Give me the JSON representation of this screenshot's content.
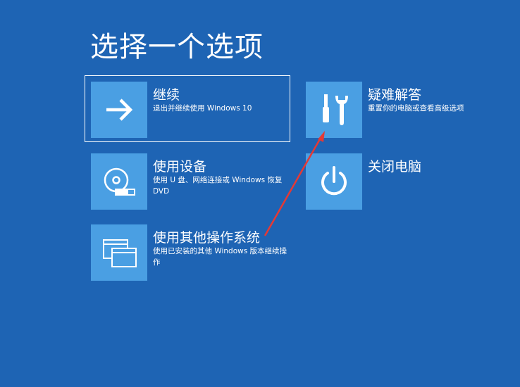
{
  "page": {
    "title": "选择一个选项"
  },
  "options": [
    {
      "label": "继续",
      "description": "退出并继续使用 Windows 10",
      "icon": "arrow-right-icon"
    },
    {
      "label": "使用设备",
      "description": "使用 U 盘、网络连接或 Windows 恢复 DVD",
      "icon": "disc-usb-icon"
    },
    {
      "label": "使用其他操作系统",
      "description": "使用已安装的其他 Windows 版本继续操作",
      "icon": "windows-stack-icon"
    },
    {
      "label": "疑难解答",
      "description": "重置你的电脑或查看高级选项",
      "icon": "tools-icon"
    },
    {
      "label": "关闭电脑",
      "description": "",
      "icon": "power-icon"
    }
  ],
  "colors": {
    "background": "#1e64b4",
    "tile": "#4a9fe3",
    "text": "#ffffff",
    "annotation_arrow": "#e53935"
  }
}
